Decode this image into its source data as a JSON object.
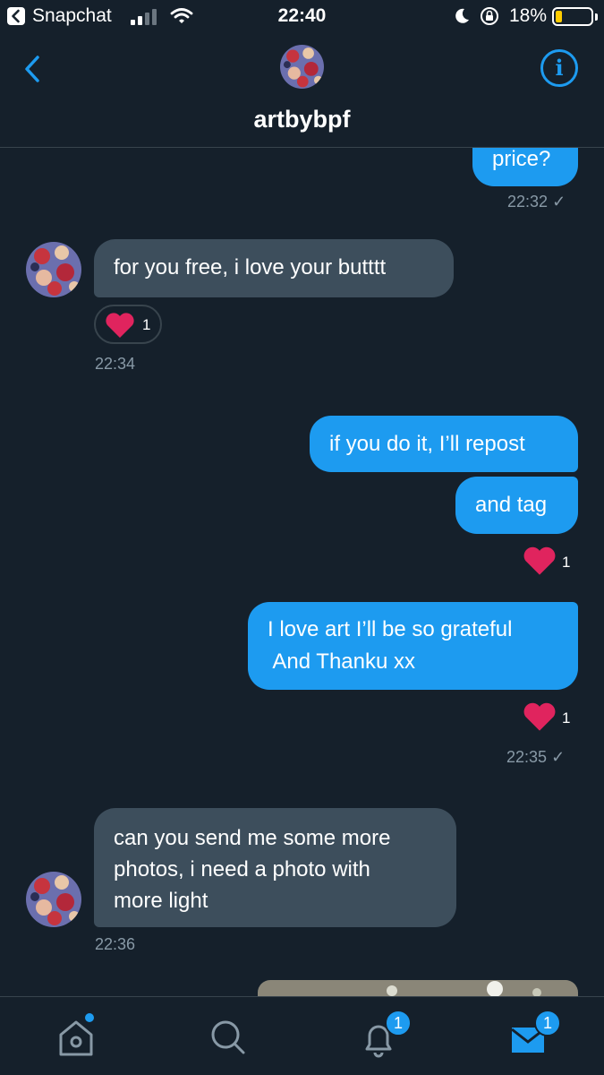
{
  "status_bar": {
    "back_app": "Snapchat",
    "time": "22:40",
    "battery": "18%",
    "battery_level": 0.18
  },
  "header": {
    "title": "artbybpf",
    "info_icon": "info-icon",
    "back_icon": "chevron-left-icon"
  },
  "messages": [
    {
      "text": "price?",
      "time": "22:32"
    },
    {
      "text": "for you free, i love your butttt",
      "time": "22:34",
      "reaction_count": "1"
    },
    {
      "text": "if you do it, I’ll repost"
    },
    {
      "text": "and tag",
      "reaction_count": "1"
    },
    {
      "line1": "I love art I’ll be so grateful",
      "line2": " And Thanku xx",
      "reaction_count": "1",
      "time": "22:35"
    },
    {
      "line1": "can you send me some more",
      "line2": "photos, i need a photo with",
      "line3": "more light",
      "time": "22:36"
    }
  ],
  "tabbar": {
    "items": [
      "home-icon",
      "search-icon",
      "notifications-icon",
      "messages-icon"
    ],
    "notifications_badge": "1",
    "messages_badge": "1"
  },
  "colors": {
    "background": "#15202b",
    "outgoing_bubble": "#1d9bf0",
    "incoming_bubble": "#3d4e5c",
    "heart": "#e0245e",
    "timestamp": "#8899a6"
  }
}
